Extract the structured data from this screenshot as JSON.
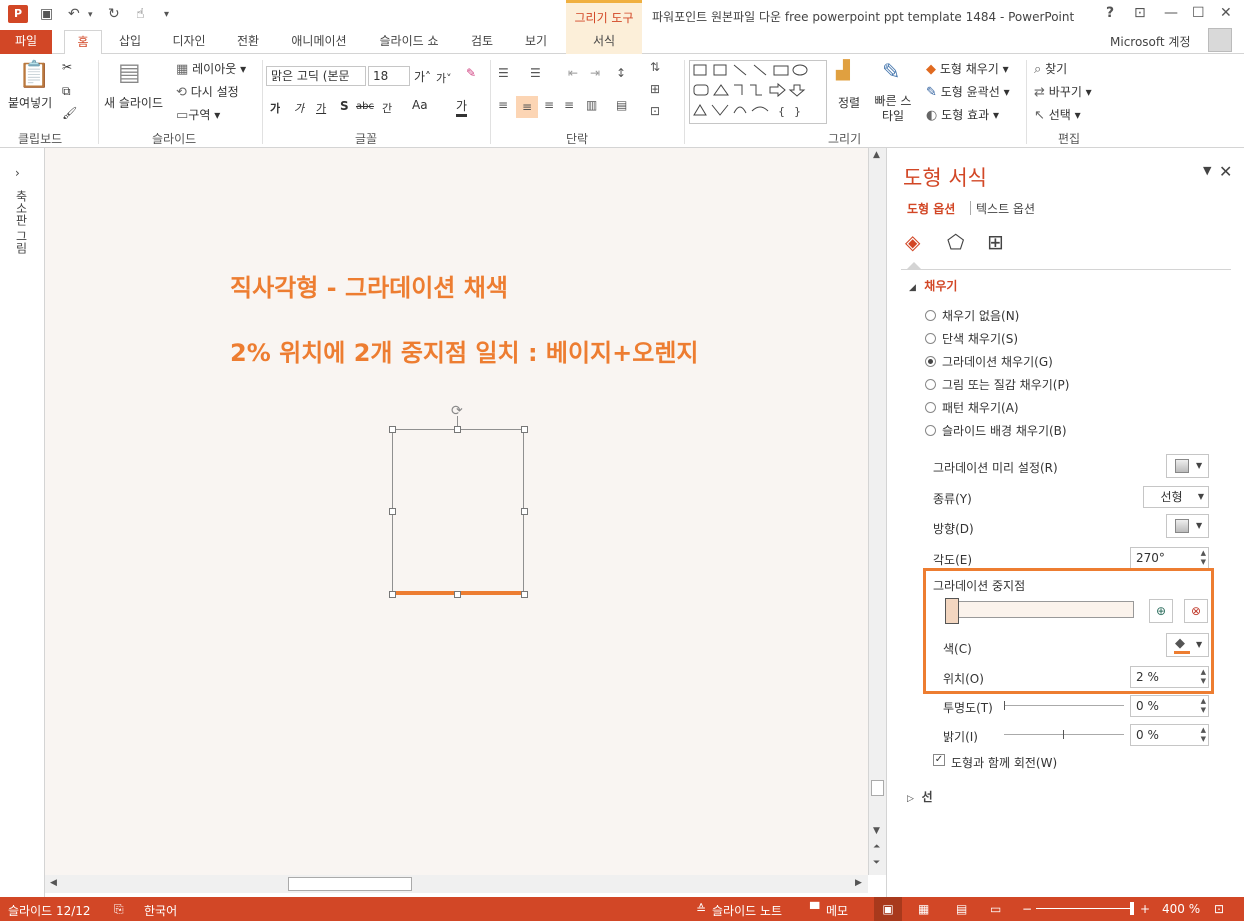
{
  "titlebar": {
    "app_icon": "P",
    "contextual_label": "그리기 도구",
    "window_title": "파워포인트 원본파일 다운 free powerpoint ppt template 1484 - PowerPoint",
    "help": "?",
    "qat_icons": [
      "save-icon",
      "undo-icon",
      "redo-icon",
      "touch-mode-icon",
      "customize-icon"
    ]
  },
  "tabs": [
    "파일",
    "홈",
    "삽입",
    "디자인",
    "전환",
    "애니메이션",
    "슬라이드 쇼",
    "검토",
    "보기",
    "서식"
  ],
  "account_label": "Microsoft 계정",
  "ribbon": {
    "clipboard": {
      "paste": "붙여넣기",
      "group": "클립보드"
    },
    "slides": {
      "new_slide": "새 슬라이드",
      "layout": "레이아웃",
      "reset": "다시 설정",
      "section": "구역",
      "group": "슬라이드"
    },
    "font": {
      "font_name": "맑은 고딕 (본문",
      "font_size": "18",
      "group": "글꼴",
      "bold": "가",
      "italic": "가",
      "underline": "가",
      "shadow": "S",
      "strike": "abc",
      "spacing": "간",
      "case": "Aa",
      "color": "가"
    },
    "paragraph": {
      "group": "단락"
    },
    "drawing": {
      "arrange": "정렬",
      "quick_styles": "빠른 스타일",
      "fill": "도형 채우기",
      "outline": "도형 윤곽선",
      "effects": "도형 효과",
      "group": "그리기"
    },
    "editing": {
      "find": "찾기",
      "replace": "바꾸기",
      "select": "선택",
      "group": "편집"
    }
  },
  "left_pane": {
    "label": "축소판 그림"
  },
  "slide": {
    "line1": "직사각형 - 그라데이션 채색",
    "line2": "2% 위치에 2개 중지점 일치 : 베이지+오렌지"
  },
  "format_pane": {
    "title": "도형 서식",
    "subtab_shape": "도형 옵션",
    "subtab_text": "텍스트 옵션",
    "fill_section": "채우기",
    "fill_options": [
      {
        "label": "채우기 없음(N)",
        "selected": false
      },
      {
        "label": "단색 채우기(S)",
        "selected": false
      },
      {
        "label": "그라데이션 채우기(G)",
        "selected": true
      },
      {
        "label": "그림 또는 질감 채우기(P)",
        "selected": false
      },
      {
        "label": "패턴 채우기(A)",
        "selected": false
      },
      {
        "label": "슬라이드 배경 채우기(B)",
        "selected": false
      }
    ],
    "preset_label": "그라데이션 미리 설정(R)",
    "type_label": "종류(Y)",
    "type_value": "선형",
    "direction_label": "방향(D)",
    "angle_label": "각도(E)",
    "angle_value": "270°",
    "stops_label": "그라데이션 중지점",
    "color_label": "색(C)",
    "position_label": "위치(O)",
    "position_value": "2 %",
    "transparency_label": "투명도(T)",
    "transparency_value": "0 %",
    "brightness_label": "밝기(I)",
    "brightness_value": "0 %",
    "rotate_label": "도형과 함께 회전(W)",
    "rotate_checked": true,
    "line_section": "선",
    "accent_color": "#ed7d31"
  },
  "statusbar": {
    "slide_info": "슬라이드 12/12",
    "language": "한국어",
    "notes": "슬라이드 노트",
    "comments": "메모",
    "zoom": "400 %"
  }
}
